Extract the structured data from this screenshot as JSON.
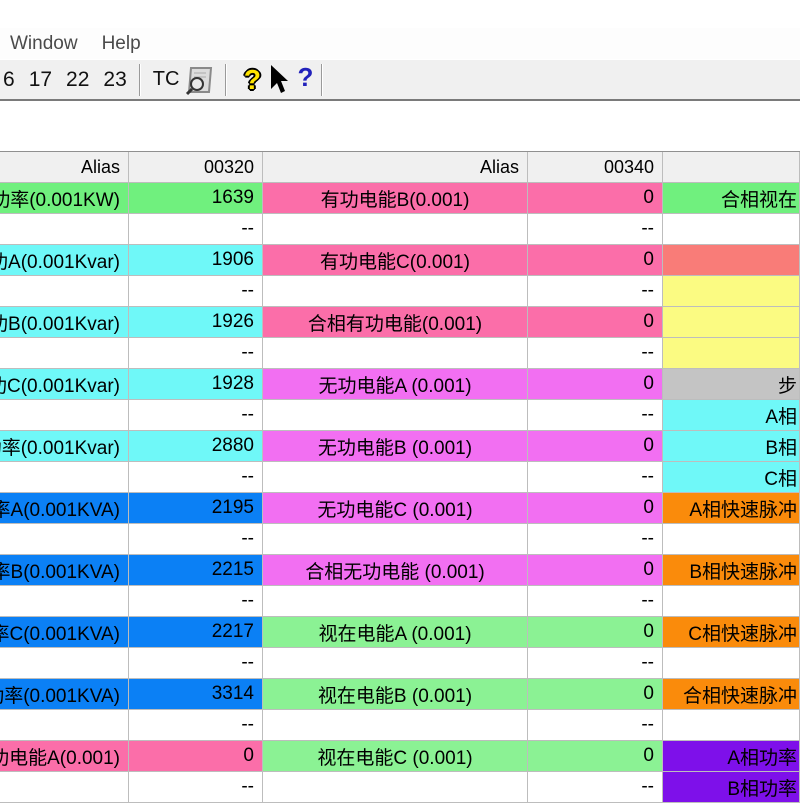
{
  "menu": {
    "items": [
      "Window",
      "Help"
    ]
  },
  "toolbar": {
    "numbers": [
      "6",
      "17",
      "22",
      "23"
    ],
    "tc_label": "TC",
    "icons": [
      "zoom-document-icon",
      "help-icon",
      "context-help-icon"
    ]
  },
  "table": {
    "headers": {
      "alias1": "Alias",
      "id1": "00320",
      "alias2": "Alias",
      "id2": "00340",
      "col5": ""
    },
    "rows": [
      {
        "c1": "功率(0.001KW)",
        "v1": "1639",
        "bgA": "green",
        "c3": "有功电能B(0.001)",
        "v3": "0",
        "bgB": "pink",
        "c5": "合相视在",
        "bgC": "green"
      },
      {
        "c1": "",
        "v1": "--",
        "bgA": "white",
        "c3": "",
        "v3": "--",
        "bgB": "white",
        "c5": "",
        "bgC": "white"
      },
      {
        "c1": "功A(0.001Kvar)",
        "v1": "1906",
        "bgA": "cyan",
        "c3": "有功电能C(0.001)",
        "v3": "0",
        "bgB": "pink",
        "c5": "",
        "bgC": "salmon"
      },
      {
        "c1": "",
        "v1": "--",
        "bgA": "white",
        "c3": "",
        "v3": "--",
        "bgB": "white",
        "c5": "",
        "bgC": "yellow"
      },
      {
        "c1": "功B(0.001Kvar)",
        "v1": "1926",
        "bgA": "cyan",
        "c3": "合相有功电能(0.001)",
        "v3": "0",
        "bgB": "pink",
        "c5": "",
        "bgC": "yellow"
      },
      {
        "c1": "",
        "v1": "--",
        "bgA": "white",
        "c3": "",
        "v3": "--",
        "bgB": "white",
        "c5": "",
        "bgC": "yellow"
      },
      {
        "c1": "功C(0.001Kvar)",
        "v1": "1928",
        "bgA": "cyan",
        "c3": "无功电能A (0.001)",
        "v3": "0",
        "bgB": "magenta",
        "c5": "步",
        "bgC": "gray"
      },
      {
        "c1": "",
        "v1": "--",
        "bgA": "white",
        "c3": "",
        "v3": "--",
        "bgB": "white",
        "c5": "A相",
        "bgC": "cyan"
      },
      {
        "c1": "功率(0.001Kvar)",
        "v1": "2880",
        "bgA": "cyan",
        "c3": "无功电能B (0.001)",
        "v3": "0",
        "bgB": "magenta",
        "c5": "B相",
        "bgC": "cyan"
      },
      {
        "c1": "",
        "v1": "--",
        "bgA": "white",
        "c3": "",
        "v3": "--",
        "bgB": "white",
        "c5": "C相",
        "bgC": "cyan"
      },
      {
        "c1": "率A(0.001KVA)",
        "v1": "2195",
        "bgA": "blue",
        "c3": "无功电能C (0.001)",
        "v3": "0",
        "bgB": "magenta",
        "c5": "A相快速脉冲",
        "bgC": "orange"
      },
      {
        "c1": "",
        "v1": "--",
        "bgA": "white",
        "c3": "",
        "v3": "--",
        "bgB": "white",
        "c5": "",
        "bgC": "white"
      },
      {
        "c1": "率B(0.001KVA)",
        "v1": "2215",
        "bgA": "blue",
        "c3": "合相无功电能 (0.001)",
        "v3": "0",
        "bgB": "magenta",
        "c5": "B相快速脉冲",
        "bgC": "orange"
      },
      {
        "c1": "",
        "v1": "--",
        "bgA": "white",
        "c3": "",
        "v3": "--",
        "bgB": "white",
        "c5": "",
        "bgC": "white"
      },
      {
        "c1": "率C(0.001KVA)",
        "v1": "2217",
        "bgA": "blue",
        "c3": "视在电能A (0.001)",
        "v3": "0",
        "bgB": "green_light",
        "c5": "C相快速脉冲",
        "bgC": "orange"
      },
      {
        "c1": "",
        "v1": "--",
        "bgA": "white",
        "c3": "",
        "v3": "--",
        "bgB": "white",
        "c5": "",
        "bgC": "white"
      },
      {
        "c1": "功率(0.001KVA)",
        "v1": "3314",
        "bgA": "blue",
        "c3": "视在电能B (0.001)",
        "v3": "0",
        "bgB": "green_light",
        "c5": "合相快速脉冲",
        "bgC": "orange"
      },
      {
        "c1": "",
        "v1": "--",
        "bgA": "white",
        "c3": "",
        "v3": "--",
        "bgB": "white",
        "c5": "",
        "bgC": "white"
      },
      {
        "c1": "功电能A(0.001)",
        "v1": "0",
        "bgA": "pink",
        "c3": "视在电能C (0.001)",
        "v3": "0",
        "bgB": "green_light",
        "c5": "A相功率",
        "bgC": "purple"
      },
      {
        "c1": "",
        "v1": "--",
        "bgA": "white",
        "c3": "",
        "v3": "--",
        "bgB": "white",
        "c5": "B相功率",
        "bgC": "purple"
      }
    ]
  },
  "colors": {
    "green": "#70F07E",
    "green_light": "#8BF294",
    "cyan": "#6FF8F8",
    "blue": "#0B80F5",
    "pink": "#FB6EA9",
    "magenta": "#F26FF2",
    "salmon": "#F97C78",
    "yellow": "#FBFB82",
    "gray": "#C4C4C4",
    "orange": "#FA8B0B",
    "purple": "#7E10EA",
    "white": "#FFFFFF"
  }
}
